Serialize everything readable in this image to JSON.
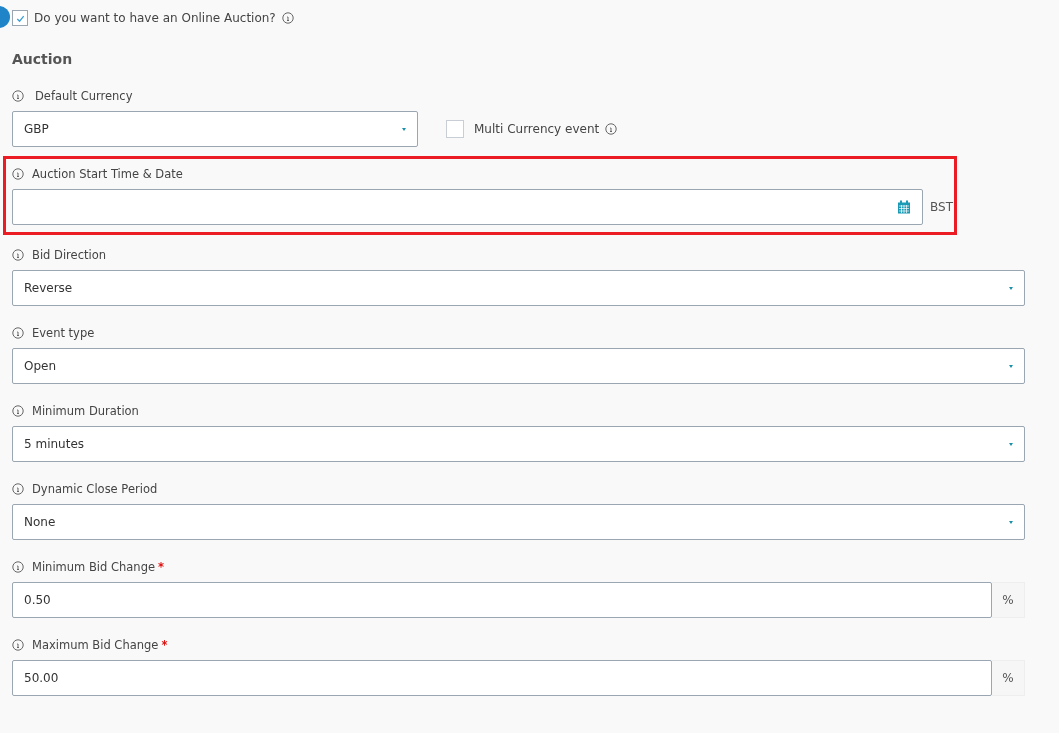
{
  "online_auction": {
    "label": "Do you want to have an Online Auction?",
    "checked": true
  },
  "section_title": "Auction",
  "fields": [
    {
      "kind": "select",
      "label": "Default Currency",
      "value": "GBP",
      "highlighted": false,
      "narrow": true,
      "extra_checkbox": {
        "label": "Multi Currency event",
        "checked": false
      }
    },
    {
      "kind": "date",
      "label": "Auction Start Time & Date",
      "highlighted": true,
      "suffix": "BST"
    },
    {
      "kind": "select",
      "label": "Bid Direction",
      "value": "Reverse",
      "highlighted": false
    },
    {
      "kind": "select",
      "label": "Event type",
      "value": "Open",
      "highlighted": false
    },
    {
      "kind": "select",
      "label": "Minimum Duration",
      "value": "5 minutes",
      "highlighted": false
    },
    {
      "kind": "select",
      "label": "Dynamic Close Period",
      "value": "None",
      "highlighted": false
    },
    {
      "kind": "number",
      "label": "Minimum Bid Change",
      "value": "0.50",
      "required_mark": "*",
      "highlighted": false,
      "addon": "%"
    },
    {
      "kind": "number",
      "label": "Maximum Bid Change",
      "value": "50.00",
      "required_mark": "*",
      "highlighted": false,
      "addon": "%"
    }
  ]
}
